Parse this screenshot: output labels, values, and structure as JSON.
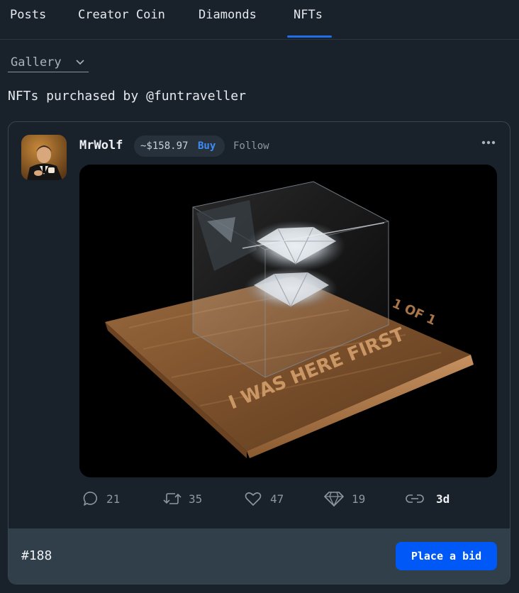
{
  "tabs": [
    {
      "label": "Posts"
    },
    {
      "label": "Creator Coin"
    },
    {
      "label": "Diamonds"
    },
    {
      "label": "NFTs",
      "active": true
    }
  ],
  "filter": {
    "selected": "Gallery",
    "icon": "chevron-down-icon"
  },
  "heading": "NFTs purchased by @funtraveller",
  "post": {
    "username": "MrWolf",
    "coin_price": "~$158.97",
    "buy_label": "Buy",
    "follow_label": "Follow",
    "image_texts": [
      "I WAS HERE FIRST",
      "1 OF 1"
    ],
    "actions": {
      "comments": "21",
      "reposts": "35",
      "likes": "47",
      "diamonds": "19",
      "age": "3d"
    },
    "serial": "#188",
    "bid_label": "Place a bid"
  },
  "colors": {
    "background": "#19212b",
    "accent": "#1f6feb",
    "button": "#0059f7",
    "footer": "#313f4a"
  }
}
